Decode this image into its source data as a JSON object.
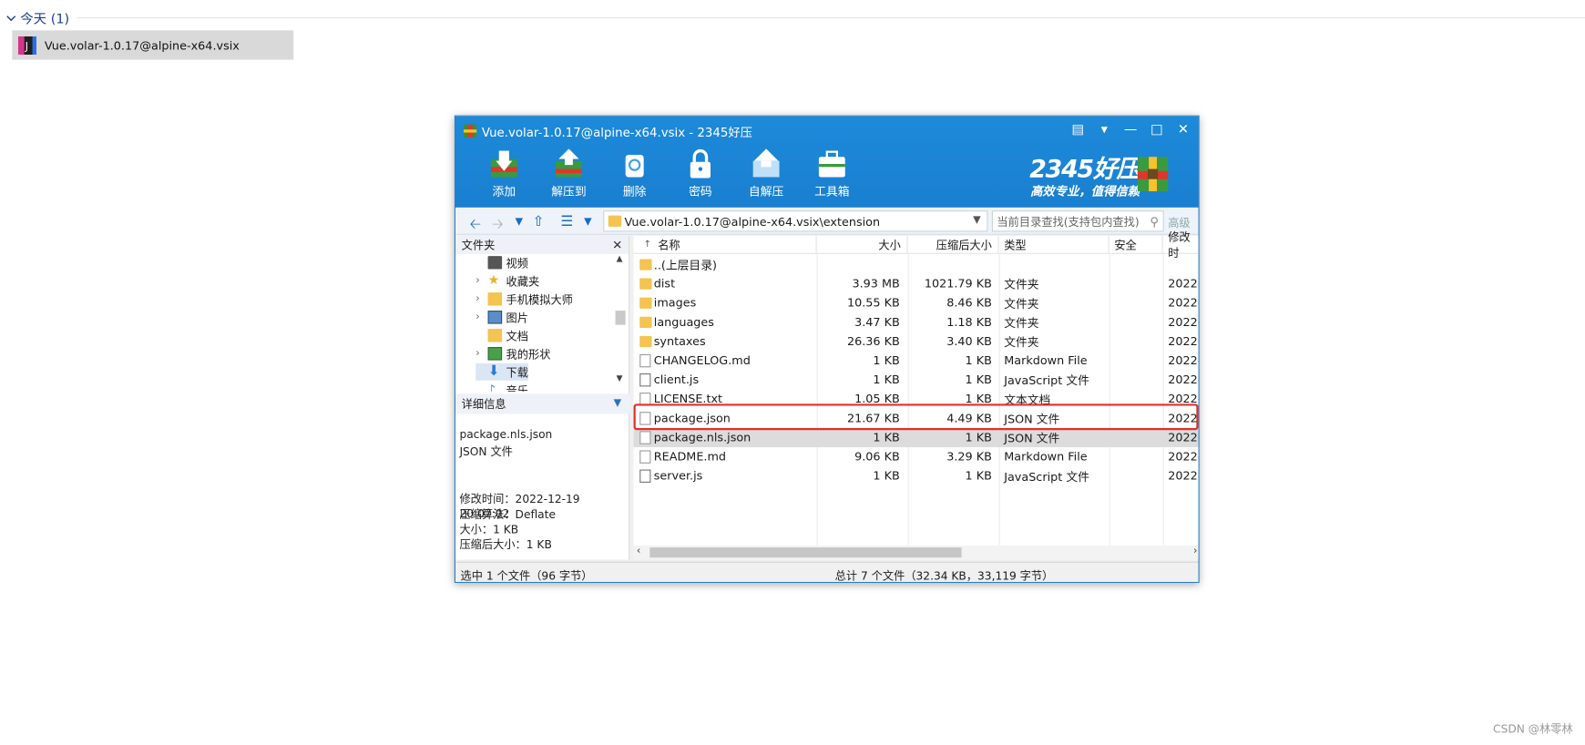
{
  "explorer": {
    "group_label": "今天 (1)",
    "file_name": "Vue.volar-1.0.17@alpine-x64.vsix"
  },
  "window": {
    "title": "Vue.volar-1.0.17@alpine-x64.vsix - 2345好压",
    "toolbar": [
      "添加",
      "解压到",
      "删除",
      "密码",
      "自解压",
      "工具箱"
    ],
    "brand": {
      "name": "2345好压",
      "slogan": "高效专业，值得信赖"
    },
    "address": "Vue.volar-1.0.17@alpine-x64.vsix\\extension",
    "search_placeholder": "当前目录查找(支持包内查找)",
    "advanced_label": "高级",
    "left_pane": {
      "header": "文件夹",
      "tree": [
        {
          "label": "视频",
          "expandable": false,
          "icon": "video-folder-icon"
        },
        {
          "label": "收藏夹",
          "expandable": true,
          "icon": "star-icon"
        },
        {
          "label": "手机模拟大师",
          "expandable": true,
          "icon": "folder-icon"
        },
        {
          "label": "图片",
          "expandable": true,
          "icon": "picture-icon"
        },
        {
          "label": "文档",
          "expandable": false,
          "icon": "folder-icon"
        },
        {
          "label": "我的形状",
          "expandable": true,
          "icon": "shapes-icon"
        },
        {
          "label": "下载",
          "expandable": false,
          "icon": "download-icon"
        },
        {
          "label": "音乐",
          "expandable": false,
          "icon": "music-icon"
        }
      ],
      "details_header": "详细信息",
      "details": {
        "name": "package.nls.json",
        "type": "JSON 文件",
        "modified": "修改时间：2022-12-19 20:07:02",
        "method": "压缩算法：Deflate",
        "size": "大小：1 KB",
        "packed": "压缩后大小：1 KB"
      }
    },
    "columns": [
      "名称",
      "大小",
      "压缩后大小",
      "类型",
      "安全",
      "修改时"
    ],
    "files": [
      {
        "name": "..(上层目录)",
        "size": "",
        "packed": "",
        "type": "",
        "modified": "",
        "icon": "folder"
      },
      {
        "name": "dist",
        "size": "3.93 MB",
        "packed": "1021.79 KB",
        "type": "文件夹",
        "modified": "2022-",
        "icon": "folder"
      },
      {
        "name": "images",
        "size": "10.55 KB",
        "packed": "8.46 KB",
        "type": "文件夹",
        "modified": "2022-",
        "icon": "folder"
      },
      {
        "name": "languages",
        "size": "3.47 KB",
        "packed": "1.18 KB",
        "type": "文件夹",
        "modified": "2022-",
        "icon": "folder"
      },
      {
        "name": "syntaxes",
        "size": "26.36 KB",
        "packed": "3.40 KB",
        "type": "文件夹",
        "modified": "2022-",
        "icon": "folder"
      },
      {
        "name": "CHANGELOG.md",
        "size": "1 KB",
        "packed": "1 KB",
        "type": "Markdown File",
        "modified": "2022-",
        "icon": "doc"
      },
      {
        "name": "client.js",
        "size": "1 KB",
        "packed": "1 KB",
        "type": "JavaScript 文件",
        "modified": "2022-",
        "icon": "js"
      },
      {
        "name": "LICENSE.txt",
        "size": "1.05 KB",
        "packed": "1 KB",
        "type": "文本文档",
        "modified": "2022-",
        "icon": "doc"
      },
      {
        "name": "package.json",
        "size": "21.67 KB",
        "packed": "4.49 KB",
        "type": "JSON 文件",
        "modified": "2022",
        "icon": "doc"
      },
      {
        "name": "package.nls.json",
        "size": "1 KB",
        "packed": "1 KB",
        "type": "JSON 文件",
        "modified": "2022-",
        "icon": "doc",
        "selected": true
      },
      {
        "name": "README.md",
        "size": "9.06 KB",
        "packed": "3.29 KB",
        "type": "Markdown File",
        "modified": "2022-",
        "icon": "doc"
      },
      {
        "name": "server.js",
        "size": "1 KB",
        "packed": "1 KB",
        "type": "JavaScript 文件",
        "modified": "2022-",
        "icon": "js"
      }
    ],
    "status_left": "选中 1 个文件（96 字节）",
    "status_center": "总计 7 个文件（32.34 KB，33,119 字节）"
  },
  "watermark": "CSDN @林零林",
  "colors": {
    "titlebar": "#1a80d0",
    "highlight": "#e0302a",
    "selected_row": "#dcdcdc"
  }
}
